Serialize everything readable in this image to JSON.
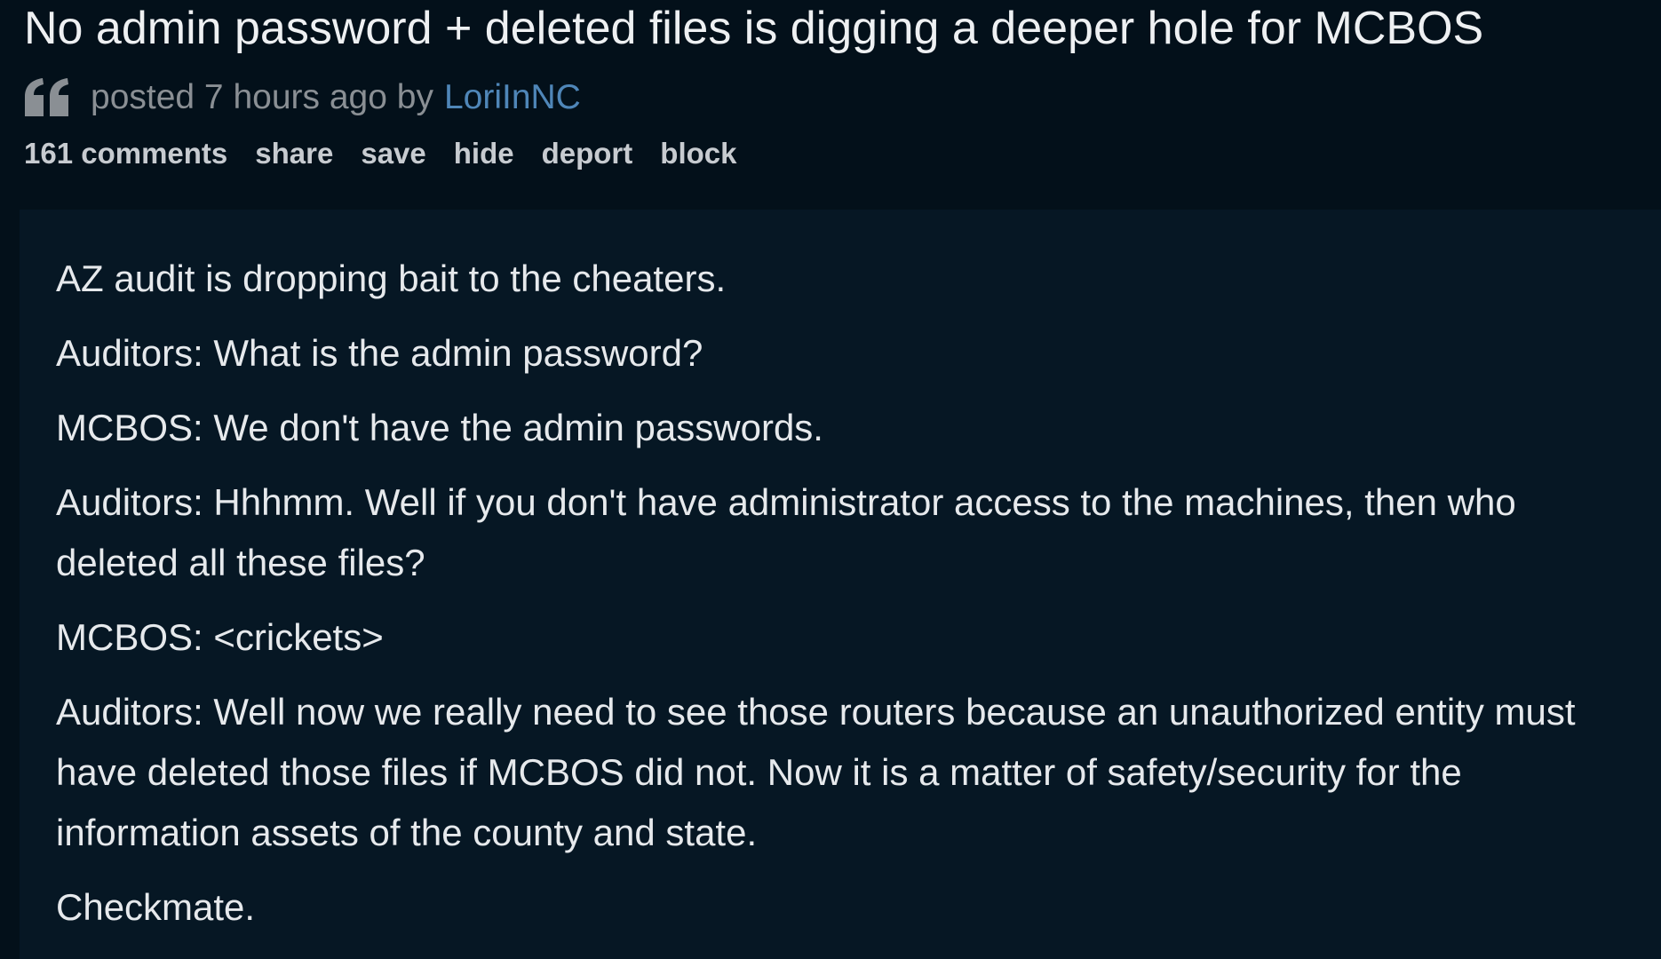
{
  "post": {
    "title": "No admin password + deleted files is digging a deeper hole for MCBOS",
    "meta": "posted 7 hours ago by",
    "author": "LoriInNC",
    "icon": "quote-icon"
  },
  "actions": {
    "comments": "161 comments",
    "share": "share",
    "save": "save",
    "hide": "hide",
    "deport": "deport",
    "block": "block"
  },
  "body": {
    "paragraphs": [
      "AZ audit is dropping bait to the cheaters.",
      "Auditors: What is the admin password?",
      "MCBOS: We don't have the admin passwords.",
      "Auditors: Hhhmm. Well if you don't have administrator access to the machines, then who deleted all these files?",
      "MCBOS: <crickets>",
      "Auditors: Well now we really need to see those routers because an unauthorized entity must have deleted those files if MCBOS did not. Now it is a matter of safety/security for the information assets of the county and state.",
      "Checkmate."
    ]
  },
  "colors": {
    "background": "#03101a",
    "body_background": "#061724",
    "author_link": "#4f86b8",
    "meta_text": "#8a8f94"
  }
}
